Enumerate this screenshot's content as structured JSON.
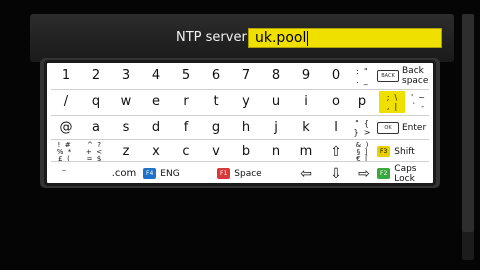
{
  "ntp": {
    "label": "NTP server:",
    "value": "uk.pool"
  },
  "rows": [
    [
      "1",
      "2",
      "3",
      "4",
      "5",
      "6",
      "7",
      "8",
      "9",
      "0"
    ],
    [
      "/",
      "q",
      "w",
      "e",
      "r",
      "t",
      "y",
      "u",
      "i",
      "o",
      "p"
    ],
    [
      "@",
      "a",
      "s",
      "d",
      "f",
      "g",
      "h",
      "j",
      "k",
      "l"
    ],
    [
      "z",
      "x",
      "c",
      "v",
      "b",
      "n",
      "m"
    ]
  ],
  "symbols": {
    "r1_col": ":  \"\n.  _",
    "r2_col": ";  \\\n,  |",
    "r3_col": "'  ~\n`  -",
    "r4_a": "!  #\n%  *\n£  (",
    "r4_b": "^  ?\n+  <\n=  $",
    "r4_c": "&  )\n§  ]\n€  [",
    "r4_d": "\"  {\n}  >"
  },
  "keys": {
    "back_space": "Back space",
    "enter": "Enter",
    "shift": "Shift",
    "caps_lock": "Caps Lock",
    "com": ".com",
    "eng": "ENG",
    "space": "Space",
    "back_icon": "BACK",
    "enter_icon": "OK",
    "badge_f4": "F4",
    "badge_f1": "F1",
    "badge_f3": "F3",
    "badge_f2": "F2",
    "left_arrow": "⇦",
    "down_arrow": "⇩",
    "right_arrow": "⇨",
    "shift_arrow": "⇧"
  },
  "colors": {
    "highlight": "#f0e000",
    "f4": "#1e73c8",
    "f1": "#d63a3a",
    "f3": "#e8d000",
    "f2": "#3aa83a"
  }
}
